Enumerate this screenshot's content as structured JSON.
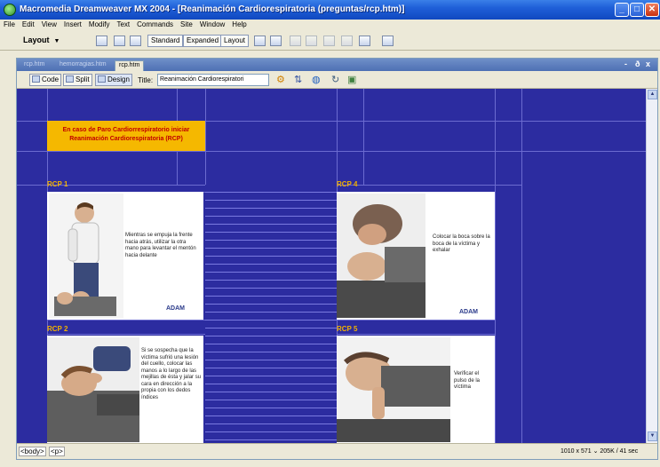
{
  "window": {
    "title": "Macromedia Dreamweaver MX 2004 - [Reanimación Cardiorespiratoria (preguntas/rcp.htm)]",
    "minimize_label": "_",
    "maximize_label": "□",
    "close_label": "✕"
  },
  "menu": [
    "File",
    "Edit",
    "View",
    "Insert",
    "Modify",
    "Text",
    "Commands",
    "Site",
    "Window",
    "Help"
  ],
  "toolbar": {
    "layout_label": "Layout",
    "standard_label": "Standard",
    "expanded_label": "Expanded",
    "layout_btn_label": "Layout"
  },
  "doc_tabs": [
    "rcp.htm",
    "hemorragias.htm",
    "rcp.htm"
  ],
  "doc_controls": {
    "minimize": "-",
    "restore": "ð",
    "close": "x"
  },
  "doc_toolbar": {
    "code_label": "Code",
    "split_label": "Split",
    "design_label": "Design",
    "title_label": "Title:",
    "title_value": "Reanimación Cardiorespiratori"
  },
  "page": {
    "notice_line1": "En caso de Paro Cardiorrespiratorio iniciar",
    "notice_line2": "Reanimación Cardiorespiratoria (RCP)",
    "rcp1": {
      "label": "RCP 1",
      "text": "Mientras se empuja la frente hacia atrás, utilizar la otra mano para levantar el mentón hacia delante",
      "logo": "ADAM"
    },
    "rcp2": {
      "label": "RCP 2",
      "text": "Si se sospecha que la víctima sufrió una lesión del cuello, colocar las manos a lo largo de las mejillas de ésta y jalar su cara en dirección a la propia con los dedos índices"
    },
    "rcp4": {
      "label": "RCP 4",
      "text": "Colocar la boca sobre la boca de la víctima y exhalar",
      "logo": "ADAM"
    },
    "rcp5": {
      "label": "RCP 5",
      "text": "Verificar el pulso de la víctima"
    }
  },
  "statusbar": {
    "tags": [
      "<body>",
      "<p>"
    ],
    "info": "1010 x 571 ⌄ 205K / 41 sec"
  },
  "colors": {
    "page_bg": "#2c2ca0",
    "notice_bg": "#f5b800",
    "notice_text": "#c00000",
    "label_color": "#f0b000"
  }
}
